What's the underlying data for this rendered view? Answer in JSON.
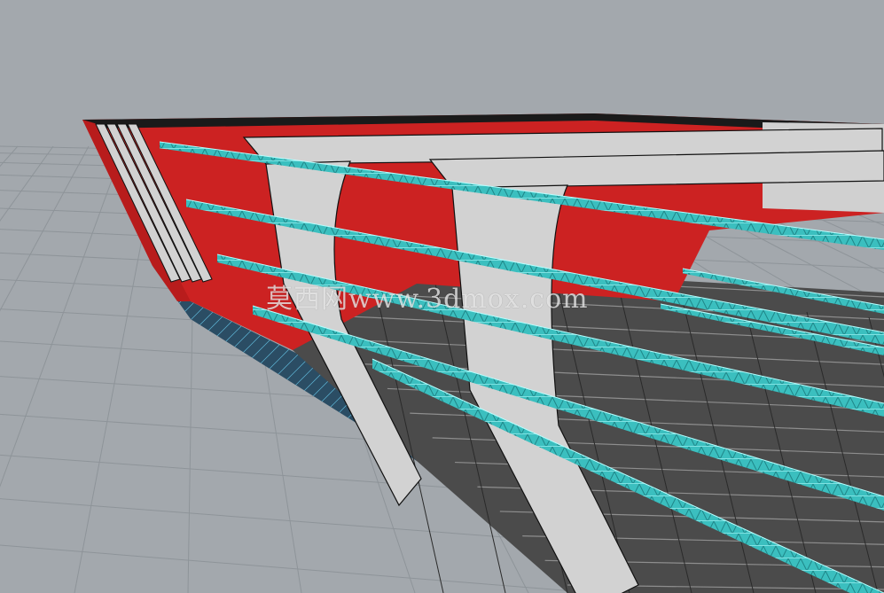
{
  "viewport": {
    "background": "#a3a8ad",
    "grid_color": "#8e9499"
  },
  "model": {
    "hull_color": "#cc2222",
    "frame_color": "#d2d2d2",
    "stringer_color": "#3bbfbf",
    "deck_color": "#3a3a3a",
    "plank_color": "#8e8e8e",
    "bottom_mesh_color": "#2e5e7a"
  },
  "watermark": {
    "text": "莫西网www.3dmox.com"
  }
}
